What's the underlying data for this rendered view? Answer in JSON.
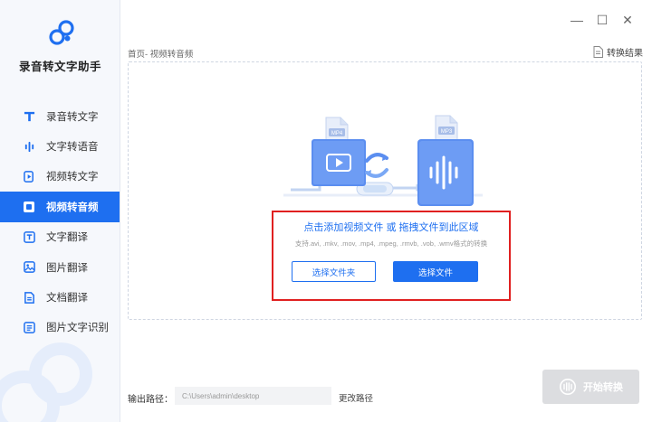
{
  "app": {
    "title": "录音转文字助手"
  },
  "sidebar": {
    "items": [
      {
        "label": "录音转文字",
        "icon": "text-t-icon",
        "active": false
      },
      {
        "label": "文字转语音",
        "icon": "audio-bars-icon",
        "active": false
      },
      {
        "label": "视频转文字",
        "icon": "video-play-icon",
        "active": false
      },
      {
        "label": "视频转音频",
        "icon": "video-audio-icon",
        "active": true
      },
      {
        "label": "文字翻译",
        "icon": "translate-text-icon",
        "active": false
      },
      {
        "label": "图片翻译",
        "icon": "image-translate-icon",
        "active": false
      },
      {
        "label": "文档翻译",
        "icon": "document-translate-icon",
        "active": false
      },
      {
        "label": "图片文字识别",
        "icon": "image-ocr-icon",
        "active": false
      }
    ]
  },
  "window_controls": {
    "minimize": "—",
    "maximize": "☐",
    "close": "✕"
  },
  "breadcrumb": "首页- 视频转音频",
  "result_link": "转换结果",
  "dropzone": {
    "badge_left": "MP4",
    "badge_right": "MP3",
    "title": "点击添加视频文件 或 拖拽文件到此区域",
    "subtitle": "支持.avi, .mkv, .mov, .mp4, .mpeg, .rmvb, .vob, .wmv格式的转换",
    "select_folder_label": "选择文件夹",
    "select_file_label": "选择文件"
  },
  "output": {
    "label": "输出路径：",
    "path": "C:\\Users\\admin\\desktop",
    "change_label": "更改路径"
  },
  "start_button": "开始转换",
  "colors": {
    "accent": "#1e6ff0",
    "highlight": "#e02020",
    "disabled": "#dcdde0"
  }
}
